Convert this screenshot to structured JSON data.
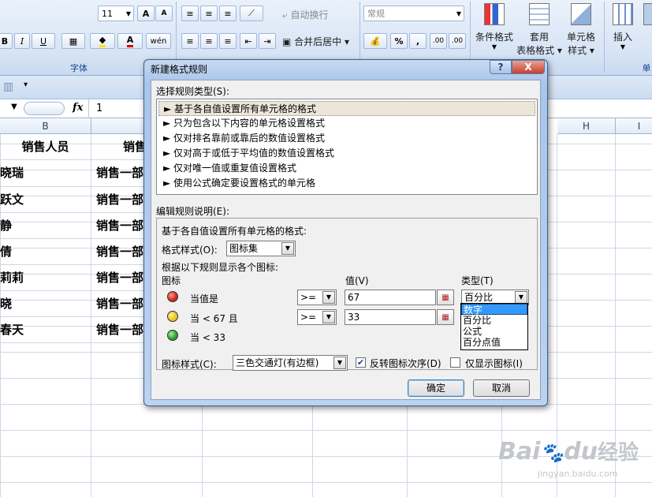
{
  "ribbon": {
    "font_size": "11",
    "wrap_text": "自动换行",
    "number_format": "常规",
    "merge_center": "合并后居中",
    "percent": "%",
    "comma": ",",
    "inc_dec": ".00",
    "dec_dec": ".00",
    "font_group": "字体",
    "conditional_format": "条件格式",
    "apply_table_1": "套用",
    "apply_table_2": "表格格式",
    "cell_style_1": "单元格",
    "cell_style_2": "样式",
    "insert": "插入",
    "cells_group": "单",
    "bold": "B",
    "italic": "I",
    "underline": "U",
    "font_color": "A",
    "phonetic": "wén"
  },
  "formula_bar": {
    "fx": "fx",
    "value": "1"
  },
  "columns": [
    "B",
    "H",
    "I"
  ],
  "sheet": {
    "header_b": "销售人员",
    "header_c": "销售",
    "names": [
      "晓瑞",
      "跃文",
      "静",
      "倩",
      "莉莉",
      "晓",
      "春天"
    ],
    "dept": "销售一部"
  },
  "dialog": {
    "title": "新建格式规则",
    "help": "?",
    "close": "X",
    "select_type_label": "选择规则类型(S):",
    "rule_types": [
      "► 基于各自值设置所有单元格的格式",
      "► 只为包含以下内容的单元格设置格式",
      "► 仅对排名靠前或靠后的数值设置格式",
      "► 仅对高于或低于平均值的数值设置格式",
      "► 仅对唯一值或重复值设置格式",
      "► 使用公式确定要设置格式的单元格"
    ],
    "edit_desc_label": "编辑规则说明(E):",
    "desc_title": "基于各自值设置所有单元格的格式:",
    "format_style_label": "格式样式(O):",
    "format_style_value": "图标集",
    "rules_label": "根据以下规则显示各个图标:",
    "icon_header": "图标",
    "value_header": "值(V)",
    "type_header": "类型(T)",
    "rows": [
      {
        "label": "当值是",
        "op": ">=",
        "value": "67",
        "type": "百分比"
      },
      {
        "label": "当 < 67 且",
        "op": ">=",
        "value": "33"
      },
      {
        "label": "当 < 33"
      }
    ],
    "type_options": [
      "数字",
      "百分比",
      "公式",
      "百分点值"
    ],
    "icon_style_label": "图标样式(C):",
    "icon_style_value": "三色交通灯(有边框)",
    "reverse_order": "反转图标次序(D)",
    "icon_only": "仅显示图标(I)",
    "ok": "确定",
    "cancel": "取消",
    "colors": {
      "red": "#d0231c",
      "yellow": "#e8c21a",
      "green": "#2f9a2a"
    }
  },
  "watermark": {
    "brand": "Bai",
    "paw": "du",
    "cn": "经验",
    "url": "jingyan.baidu.com"
  }
}
